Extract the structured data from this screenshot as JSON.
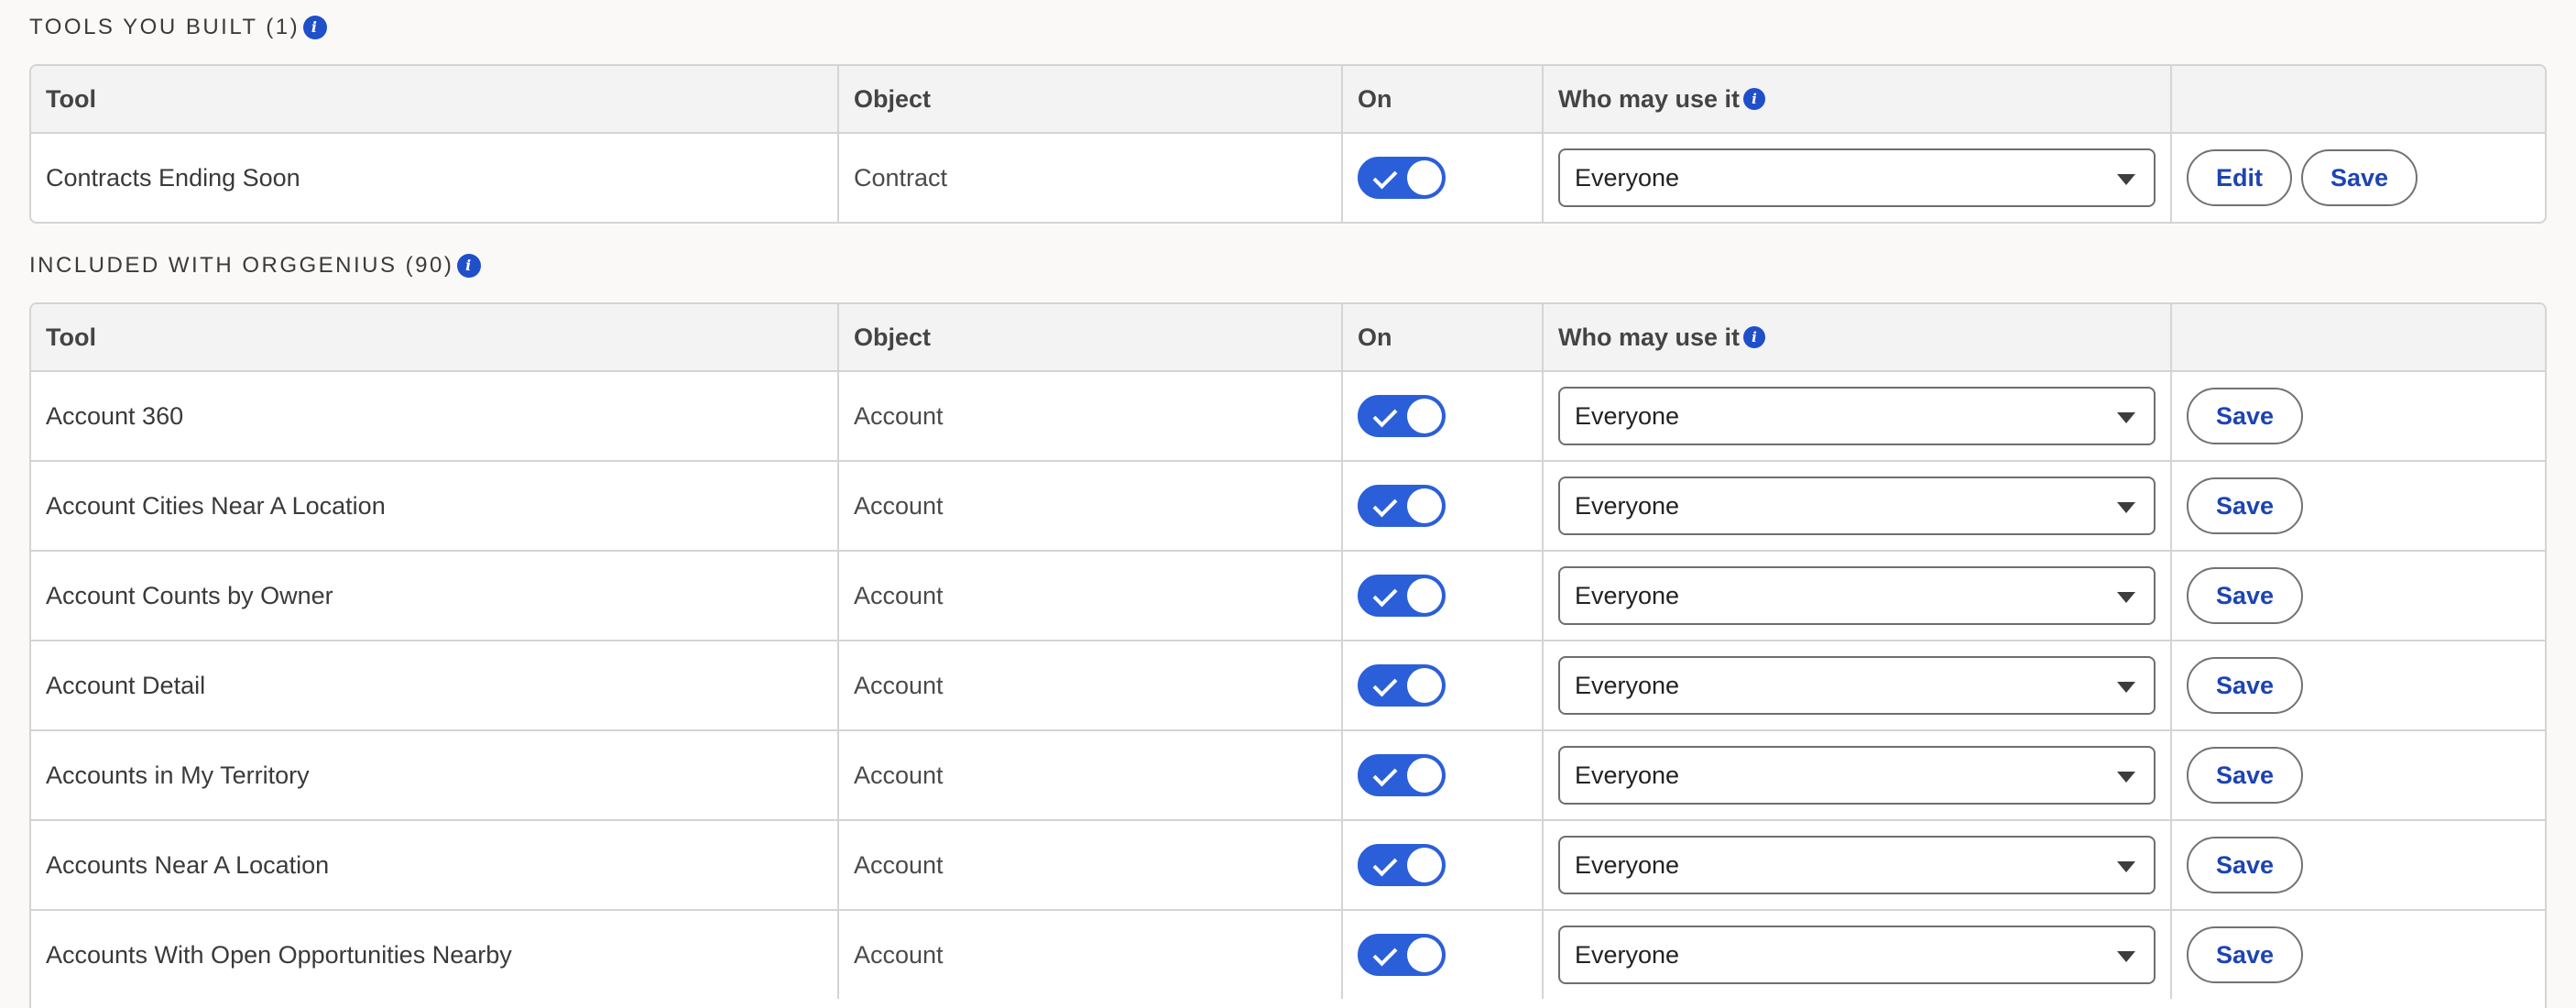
{
  "sections": {
    "built": {
      "title": "TOOLS YOU BUILT (1)",
      "columns": {
        "tool": "Tool",
        "object": "Object",
        "on": "On",
        "who": "Who may use it"
      },
      "rows": [
        {
          "tool": "Contracts Ending Soon",
          "object": "Contract",
          "on": true,
          "who": "Everyone",
          "edit_label": "Edit",
          "save_label": "Save"
        }
      ]
    },
    "included": {
      "title": "INCLUDED WITH ORGGENIUS (90)",
      "columns": {
        "tool": "Tool",
        "object": "Object",
        "on": "On",
        "who": "Who may use it"
      },
      "rows": [
        {
          "tool": "Account 360",
          "object": "Account",
          "on": true,
          "who": "Everyone",
          "save_label": "Save"
        },
        {
          "tool": "Account Cities Near A Location",
          "object": "Account",
          "on": true,
          "who": "Everyone",
          "save_label": "Save"
        },
        {
          "tool": "Account Counts by Owner",
          "object": "Account",
          "on": true,
          "who": "Everyone",
          "save_label": "Save"
        },
        {
          "tool": "Account Detail",
          "object": "Account",
          "on": true,
          "who": "Everyone",
          "save_label": "Save"
        },
        {
          "tool": "Accounts in My Territory",
          "object": "Account",
          "on": true,
          "who": "Everyone",
          "save_label": "Save"
        },
        {
          "tool": "Accounts Near A Location",
          "object": "Account",
          "on": true,
          "who": "Everyone",
          "save_label": "Save"
        },
        {
          "tool": "Accounts With Open Opportunities Nearby",
          "object": "Account",
          "on": true,
          "who": "Everyone",
          "save_label": "Save"
        }
      ]
    }
  },
  "icons": {
    "info": "info-icon",
    "check": "check-icon",
    "caret": "chevron-down-icon"
  },
  "colors": {
    "accent": "#2b5fd9",
    "link": "#1d44b3",
    "info": "#1f4fc9"
  }
}
